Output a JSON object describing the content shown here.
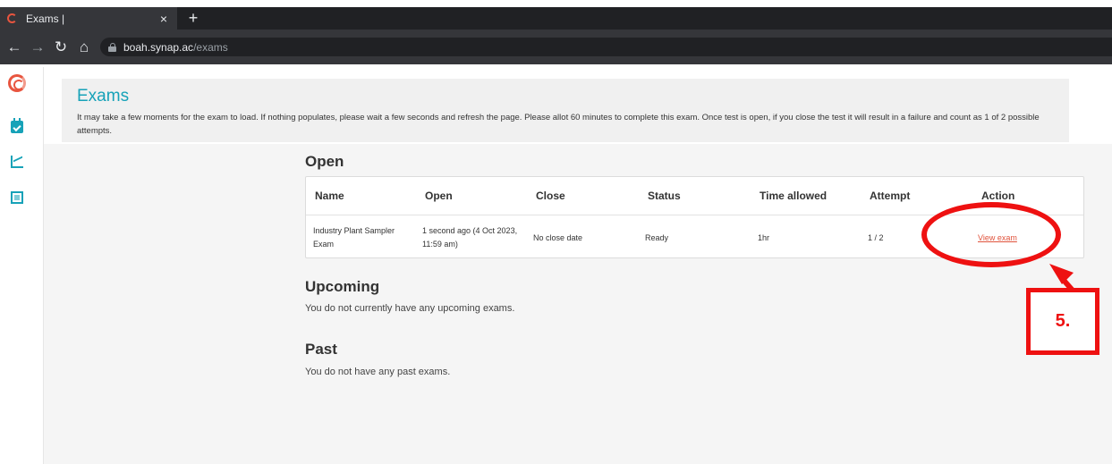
{
  "browser": {
    "tab_title": "Exams |",
    "tab_close": "×",
    "new_tab": "+",
    "url_host": "boah.synap.ac",
    "url_path": "/exams",
    "back": "←",
    "forward": "→",
    "reload": "↻",
    "home": "⌂"
  },
  "header": {
    "title": "Exams",
    "description": "It may take a few moments for the exam to load. If nothing populates, please wait a few seconds and refresh the page. Please allot 60 minutes to complete this exam. Once test is open, if you close the test it will result in a failure and count as 1 of 2 possible attempts."
  },
  "open_section": {
    "title": "Open",
    "columns": [
      "Name",
      "Open",
      "Close",
      "Status",
      "Time allowed",
      "Attempt",
      "Action"
    ],
    "row": {
      "name_line1": "Industry Plant Sampler",
      "name_line2": "Exam",
      "open_line1": "1 second ago (4 Oct 2023,",
      "open_line2": "11:59 am)",
      "close": "No close date",
      "status": "Ready",
      "time_allowed": "1hr",
      "attempt": "1 / 2",
      "action": "View exam"
    }
  },
  "upcoming_section": {
    "title": "Upcoming",
    "text": "You do not currently have any upcoming exams."
  },
  "past_section": {
    "title": "Past",
    "text": "You do not have any past exams."
  },
  "annotation": {
    "label": "5.",
    "color": "#ee1111"
  },
  "colors": {
    "accent": "#17a2b8",
    "brand": "#e8553f",
    "link": "#e0533c"
  }
}
